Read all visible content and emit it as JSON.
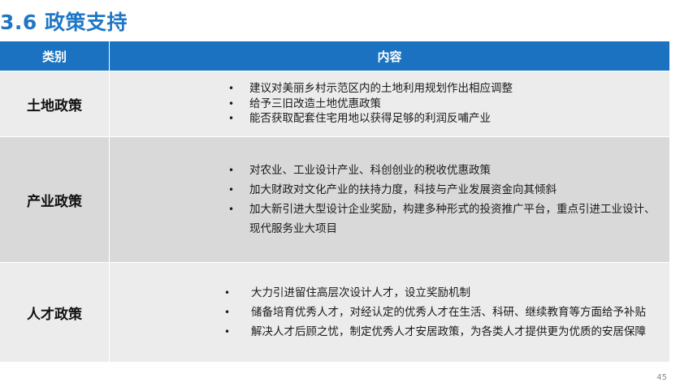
{
  "slide": {
    "title": "3.6 政策支持",
    "page_number": "45"
  },
  "table": {
    "headers": [
      "类别",
      "内容"
    ],
    "rows": [
      {
        "category": "土地政策",
        "items": [
          "建议对美丽乡村示范区内的土地利用规划作出相应调整",
          "给予三旧改造土地优惠政策",
          "能否获取配套住宅用地以获得足够的利润反哺产业"
        ]
      },
      {
        "category": "产业政策",
        "items": [
          "对农业、工业设计产业、科创创业的税收优惠政策",
          "加大财政对文化产业的扶持力度，科技与产业发展资金向其倾斜",
          "加大新引进大型设计企业奖励，构建多种形式的投资推广平台，重点引进工业设计、现代服务业大项目"
        ]
      },
      {
        "category": "人才政策",
        "items": [
          "大力引进留住高层次设计人才，设立奖励机制",
          "储备培育优秀人才，对经认定的优秀人才在生活、科研、继续教育等方面给予补贴",
          "解决人才后顾之忧，制定优秀人才安居政策，为各类人才提供更为优质的安居保障"
        ]
      }
    ],
    "bullet": "•"
  },
  "colors": {
    "title": "#1f77c4",
    "header_bg": "#1a72c0",
    "row_light": "#ececec",
    "row_dark": "#d9d9d9"
  }
}
